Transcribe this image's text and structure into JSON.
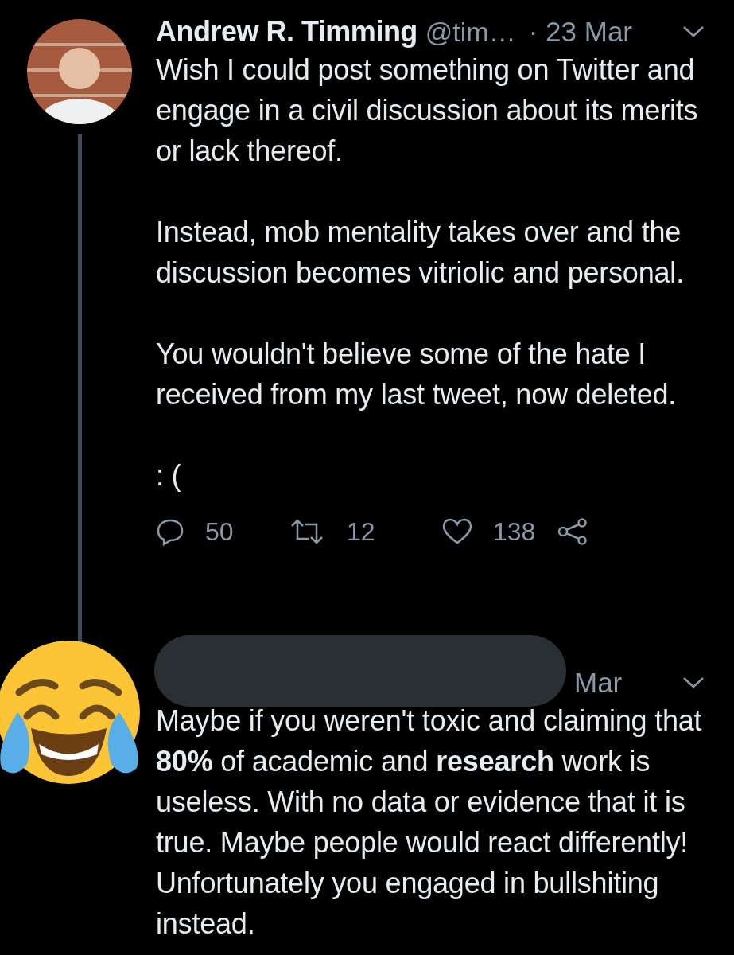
{
  "tweets": [
    {
      "author": {
        "name": "Andrew R. Timming",
        "handle": "@tim…"
      },
      "date": "· 23 Mar",
      "paragraphs": [
        "Wish I could post something on Twitter and engage in a civil discussion about its merits or lack thereof.",
        "Instead, mob mentality takes over and the discussion becomes vitriolic and personal.",
        "You wouldn't believe some of the hate I received from my last tweet, now deleted.",
        ": ("
      ],
      "actions": {
        "replies": "50",
        "retweets": "12",
        "likes": "138"
      }
    },
    {
      "author": {
        "redacted": true
      },
      "date": "Mar",
      "paragraphs": [
        "Maybe if you weren't toxic and claiming that **80%** of academic and **research** work is useless. With no data or evidence that it is true. Maybe people would react differently! Unfortunately you engaged in bullshiting instead."
      ]
    }
  ]
}
